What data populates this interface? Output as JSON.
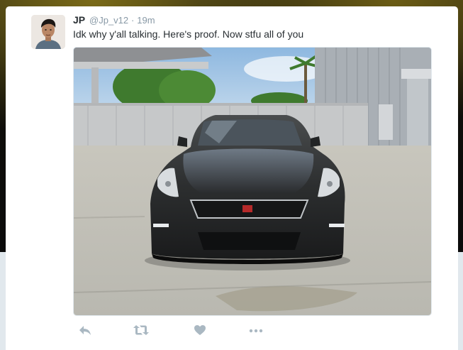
{
  "tweet": {
    "author_name": "JP",
    "author_handle": "@Jp_v12",
    "separator": "·",
    "timestamp": "19m",
    "text": "Idk why y'all talking. Here's proof. Now stfu all of you"
  },
  "media": {
    "subject": "black sports car photo",
    "grille_badge": "GT-R"
  },
  "actions": [
    {
      "icon": "reply-icon"
    },
    {
      "icon": "retweet-icon"
    },
    {
      "icon": "like-icon"
    },
    {
      "icon": "more-icon"
    }
  ],
  "colors": {
    "text": "#292f33",
    "muted": "#8899a6",
    "action_icon": "#aab8c2",
    "card_bg": "#ffffff"
  }
}
